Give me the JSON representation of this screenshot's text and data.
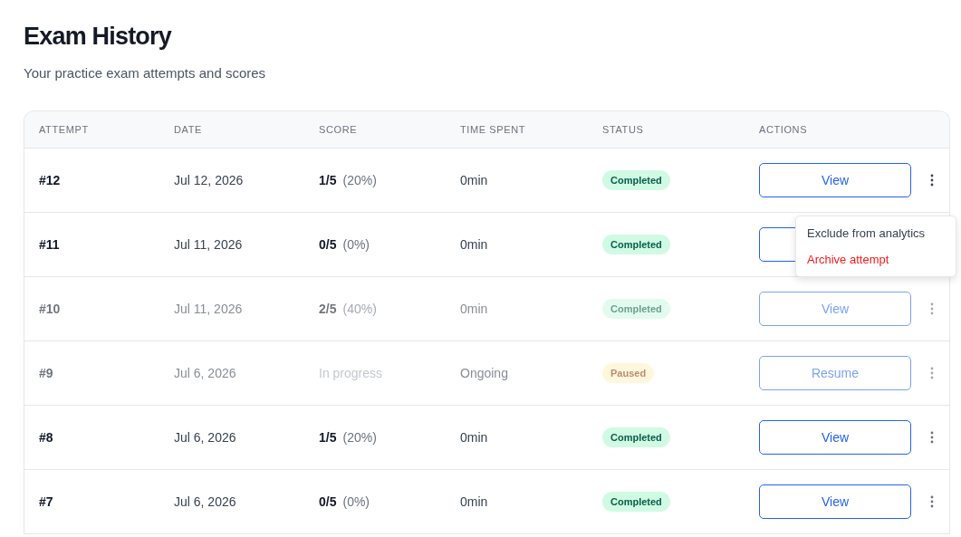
{
  "page": {
    "title": "Exam History",
    "subtitle": "Your practice exam attempts and scores"
  },
  "table": {
    "columns": [
      "ATTEMPT",
      "DATE",
      "SCORE",
      "TIME SPENT",
      "STATUS",
      "ACTIONS"
    ],
    "rows": [
      {
        "attempt": "#12",
        "date": "Jul 12, 2026",
        "score": "1/5",
        "percent": "(20%)",
        "time": "0min",
        "status": {
          "label": "Completed",
          "kind": "completed"
        },
        "action": {
          "label": "View"
        },
        "dimmed": false,
        "menu_open": true
      },
      {
        "attempt": "#11",
        "date": "Jul 11, 2026",
        "score": "0/5",
        "percent": "(0%)",
        "time": "0min",
        "status": {
          "label": "Completed",
          "kind": "completed"
        },
        "action": {},
        "dimmed": false
      },
      {
        "attempt": "#10",
        "date": "Jul 11, 2026",
        "score": "2/5",
        "percent": "(40%)",
        "time": "0min",
        "status": {
          "label": "Completed",
          "kind": "completed"
        },
        "action": {
          "label": "View"
        },
        "dimmed": true
      },
      {
        "attempt": "#9",
        "date": "Jul 6, 2026",
        "note": "In progress",
        "time": "Ongoing",
        "status": {
          "label": "Paused",
          "kind": "paused"
        },
        "action": {
          "label": "Resume"
        },
        "dimmed": true
      },
      {
        "attempt": "#8",
        "date": "Jul 6, 2026",
        "score": "1/5",
        "percent": "(20%)",
        "time": "0min",
        "status": {
          "label": "Completed",
          "kind": "completed"
        },
        "action": {
          "label": "View"
        },
        "dimmed": false
      },
      {
        "attempt": "#7",
        "date": "Jul 6, 2026",
        "score": "0/5",
        "percent": "(0%)",
        "time": "0min",
        "status": {
          "label": "Completed",
          "kind": "completed"
        },
        "action": {
          "label": "View"
        },
        "dimmed": false
      }
    ]
  },
  "row_menu": {
    "items": [
      {
        "label": "Exclude from analytics",
        "kind": "normal"
      },
      {
        "label": "Archive attempt",
        "kind": "danger"
      }
    ]
  }
}
